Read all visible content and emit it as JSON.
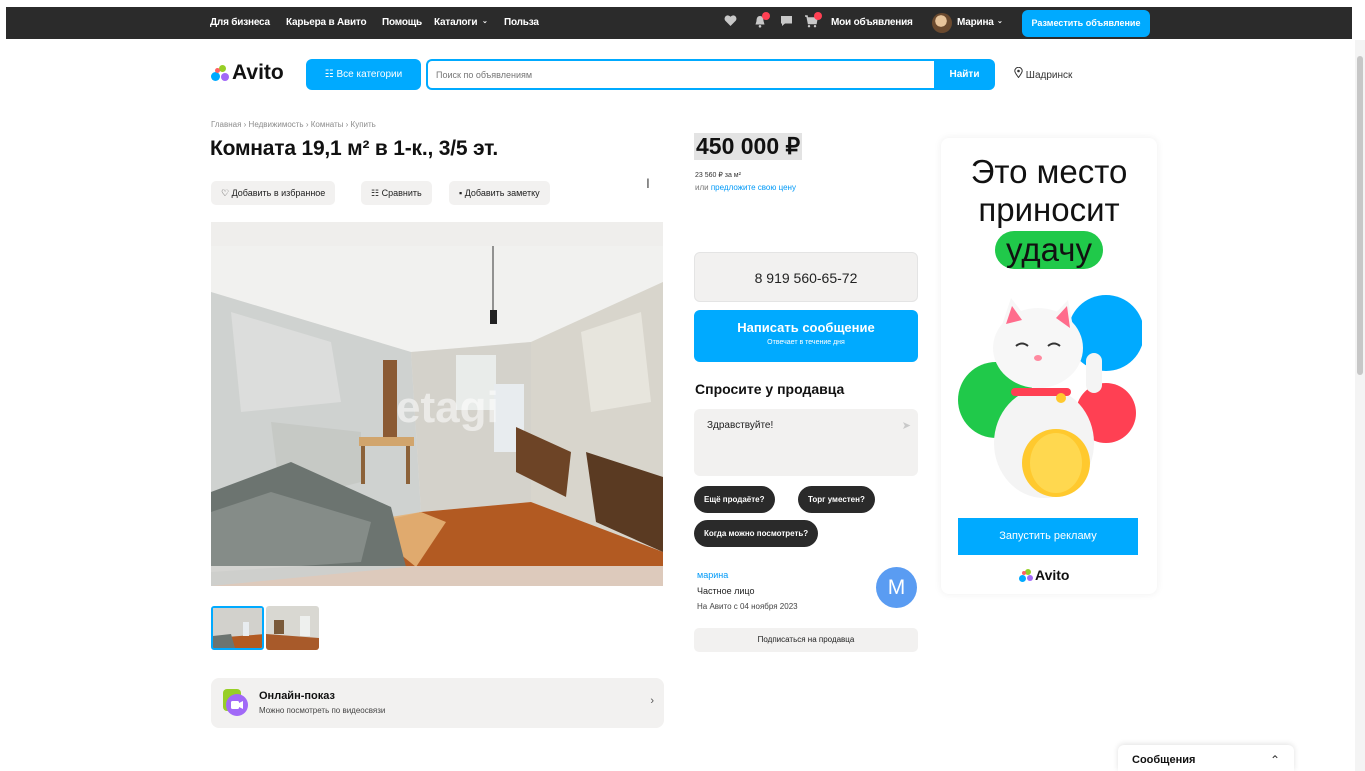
{
  "topbar": {
    "links": [
      "Для бизнеса",
      "Карьера в Авито",
      "Помощь",
      "Каталоги",
      "Польза"
    ],
    "my_ads": "Мои объявления",
    "user": "Марина",
    "post_button": "Разместить объявление",
    "icons": [
      "heart-icon",
      "bell-icon",
      "chat-icon",
      "cart-icon"
    ]
  },
  "header": {
    "logo": "Avito",
    "categories_button": "Все категории",
    "search_placeholder": "Поиск по объявлениям",
    "search_button": "Найти",
    "city": "Шадринск"
  },
  "listing": {
    "breadcrumb": "Главная › Недвижимость › Комнаты › Купить",
    "title": "Комната 19,1 м² в 1-к., 3/5 эт.",
    "actions": {
      "favorite": "Добавить в избранное",
      "compare": "Сравнить",
      "note": "Добавить заметку"
    },
    "photo_watermark": "etagi",
    "online_title": "Онлайн-показ",
    "online_sub": "Можно посмотреть по видеосвязи"
  },
  "price": {
    "value": "450 000 ₽",
    "per_m2": "23 560 ₽ за м²",
    "offer_prefix": "или",
    "offer_link": "предложите свою цену"
  },
  "contact": {
    "phone": "8 919 560-65-72",
    "message_button": "Написать сообщение",
    "message_sub": "Отвечает в течение дня",
    "ask_title": "Спросите у продавца",
    "ask_text": "Здравствуйте!",
    "chips": [
      "Ещё продаёте?",
      "Торг уместен?",
      "Когда можно посмотреть?"
    ],
    "seller_name": "марина",
    "seller_type": "Частное лицо",
    "seller_since": "На Авито с 04 ноября 2023",
    "seller_initial": "М",
    "subscribe": "Подписаться на продавца"
  },
  "ad": {
    "line1": "Это место",
    "line2": "приносит",
    "line3": "удачу",
    "button": "Запустить рекламу",
    "logo": "Avito"
  },
  "messages_panel": {
    "label": "Сообщения"
  },
  "colors": {
    "accent": "#00aaff",
    "topbar": "#2b2b2b",
    "ad_highlight": "#20c94a",
    "seller_avatar": "#5a9cf2"
  }
}
